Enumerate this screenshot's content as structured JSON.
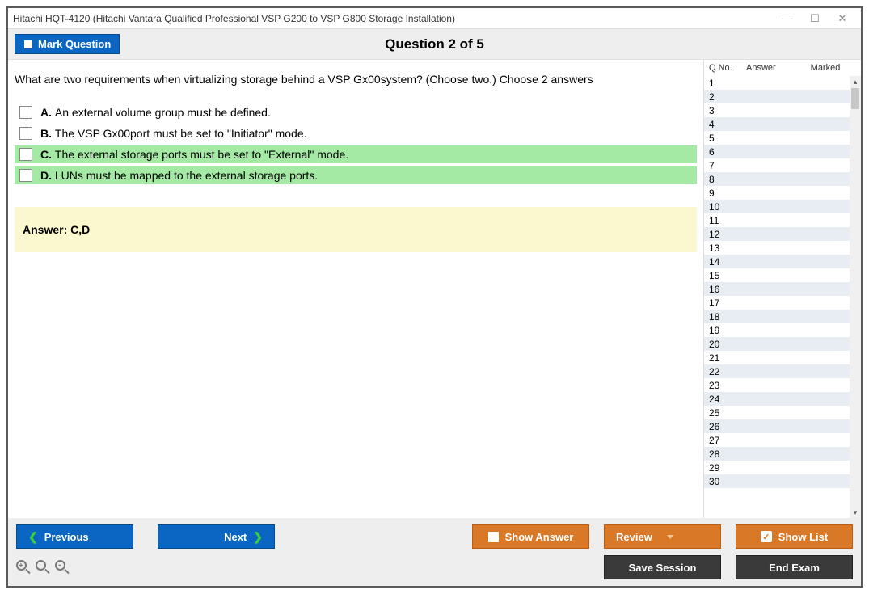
{
  "window": {
    "title": "Hitachi HQT-4120 (Hitachi Vantara Qualified Professional VSP G200 to VSP G800 Storage Installation)"
  },
  "header": {
    "mark_label": "Mark Question",
    "question_header": "Question 2 of 5"
  },
  "question": {
    "text": "What are two requirements when virtualizing storage behind a VSP Gx00system? (Choose two.) Choose 2 answers",
    "options": [
      {
        "letter": "A.",
        "text": "An external volume group must be defined.",
        "correct": false
      },
      {
        "letter": "B.",
        "text": "The VSP Gx00port must be set to \"Initiator\" mode.",
        "correct": false
      },
      {
        "letter": "C.",
        "text": "The external storage ports must be set to \"External\" mode.",
        "correct": true
      },
      {
        "letter": "D.",
        "text": "LUNs must be mapped to the external storage ports.",
        "correct": true
      }
    ],
    "answer_label": "Answer: C,D"
  },
  "sidebar": {
    "col_qno": "Q No.",
    "col_answer": "Answer",
    "col_marked": "Marked",
    "count": 30
  },
  "footer": {
    "previous": "Previous",
    "next": "Next",
    "show_answer": "Show Answer",
    "review": "Review",
    "show_list": "Show List",
    "save_session": "Save Session",
    "end_exam": "End Exam"
  }
}
